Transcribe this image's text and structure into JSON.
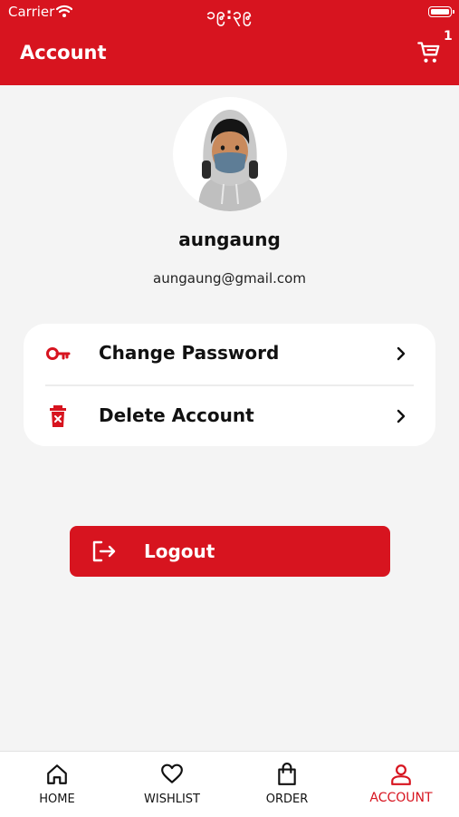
{
  "status_bar": {
    "carrier": "Carrier",
    "time": "၁၉:၃၉"
  },
  "header": {
    "title": "Account",
    "cart_count": "1"
  },
  "profile": {
    "username": "aungaung",
    "email": "aungaung@gmail.com"
  },
  "menu": [
    {
      "label": "Change Password",
      "icon": "key-icon"
    },
    {
      "label": "Delete Account",
      "icon": "trash-icon"
    }
  ],
  "logout": {
    "label": "Logout",
    "icon": "logout-icon"
  },
  "bottom_nav": [
    {
      "label": "HOME",
      "icon": "home-icon",
      "active": false
    },
    {
      "label": "WISHLIST",
      "icon": "heart-icon",
      "active": false
    },
    {
      "label": "ORDER",
      "icon": "shopping-bag-icon",
      "active": false
    },
    {
      "label": "ACCOUNT",
      "icon": "user-icon",
      "active": true
    }
  ],
  "colors": {
    "brand": "#d7141f",
    "background": "#f4f4f4",
    "card": "#ffffff",
    "text": "#111111"
  }
}
